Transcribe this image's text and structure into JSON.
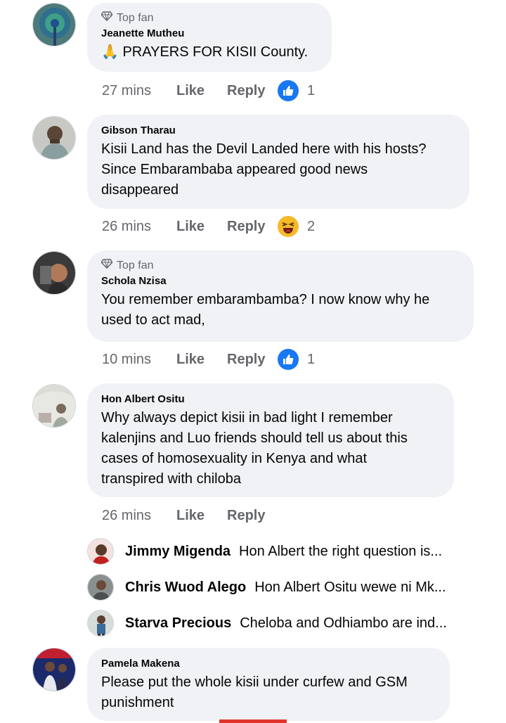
{
  "comments": [
    {
      "badge": "Top fan",
      "name": "Jeanette Mutheu",
      "text": "🙏 PRAYERS FOR KISII County.",
      "time": "27 mins",
      "like": "Like",
      "reply": "Reply",
      "reaction": "like",
      "count": "1"
    },
    {
      "badge": "",
      "name": "Gibson Tharau",
      "text_lines": [
        "Kisii Land has the Devil Landed here with his hosts?",
        "Since Embarambaba appeared good news",
        "disappeared"
      ],
      "time": "26 mins",
      "like": "Like",
      "reply": "Reply",
      "reaction": "haha",
      "count": "2"
    },
    {
      "badge": "Top fan",
      "name": "Schola Nzisa",
      "text_lines": [
        "You remember embarambamba? I now know why he",
        "used to act mad,"
      ],
      "time": "10 mins",
      "like": "Like",
      "reply": "Reply",
      "reaction": "like",
      "count": "1"
    },
    {
      "badge": "",
      "name": "Hon Albert Ositu",
      "text_lines": [
        "Why always depict kisii in bad light I remember",
        "kalenjins and Luo friends should tell us about this",
        "cases of homosexuality in Kenya and what",
        "transpired with chiloba"
      ],
      "time": "26 mins",
      "like": "Like",
      "reply": "Reply"
    },
    {
      "badge": "",
      "name": "Pamela Makena",
      "text_lines": [
        "Please put the whole kisii under curfew and GSM",
        "punishment"
      ]
    }
  ],
  "replies": [
    {
      "name": "Jimmy Migenda",
      "text": "Hon Albert the right question is..."
    },
    {
      "name": "Chris Wuod Alego",
      "text": "Hon Albert Ositu wewe ni Mk..."
    },
    {
      "name": "Starva Precious",
      "text": "Cheloba and Odhiambo are ind..."
    }
  ],
  "colors": {
    "bubble": "#f0f2f5",
    "like_blue": "#1877f2",
    "haha_yellow": "#f7b928",
    "secondary_text": "#65676b"
  }
}
